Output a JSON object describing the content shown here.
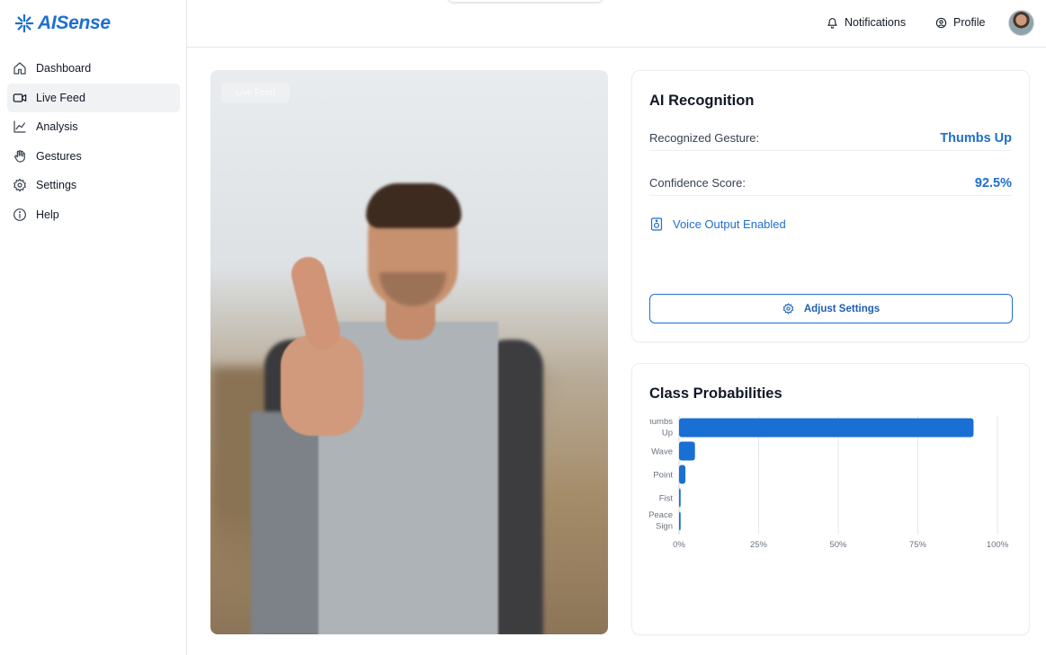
{
  "app": {
    "name": "AISense"
  },
  "sidebar": {
    "items": [
      {
        "label": "Dashboard",
        "icon": "home-icon",
        "active": false
      },
      {
        "label": "Live Feed",
        "icon": "video-icon",
        "active": true
      },
      {
        "label": "Analysis",
        "icon": "chart-line-icon",
        "active": false
      },
      {
        "label": "Gestures",
        "icon": "hand-icon",
        "active": false
      },
      {
        "label": "Settings",
        "icon": "gear-icon",
        "active": false
      },
      {
        "label": "Help",
        "icon": "info-icon",
        "active": false
      }
    ]
  },
  "topbar": {
    "notifications_label": "Notifications",
    "profile_label": "Profile"
  },
  "feed": {
    "label": "Live Feed"
  },
  "recognition": {
    "title": "AI Recognition",
    "gesture_label": "Recognized Gesture:",
    "gesture_value": "Thumbs Up",
    "confidence_label": "Confidence Score:",
    "confidence_value": "92.5%",
    "voice_label": "Voice Output Enabled",
    "adjust_button": "Adjust Settings"
  },
  "colors": {
    "accent": "#1e6fcf",
    "bar": "#1a6fd4"
  },
  "chart_data": {
    "type": "bar",
    "orientation": "horizontal",
    "title": "Class Probabilities",
    "categories": [
      "Thumbs Up",
      "Wave",
      "Point",
      "Fist",
      "Peace Sign"
    ],
    "values": [
      92.5,
      5,
      2,
      0.5,
      0.5
    ],
    "xlim": [
      0,
      100
    ],
    "xticks": [
      "0%",
      "25%",
      "50%",
      "75%",
      "100%"
    ],
    "grid": true
  }
}
